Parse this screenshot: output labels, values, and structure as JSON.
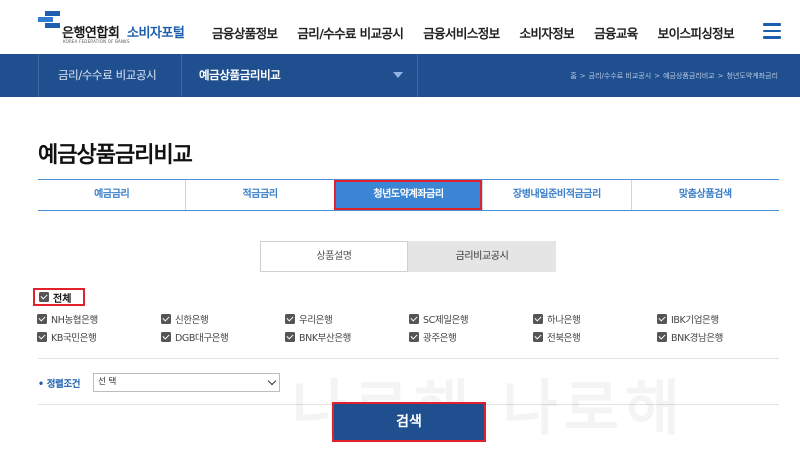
{
  "header": {
    "logo_ko": "은행연합회",
    "logo_en": "KOREA FEDERATION OF BANKS",
    "portal": "소비자포털",
    "gnb": [
      "금융상품정보",
      "금리/수수료 비교공시",
      "금융서비스정보",
      "소비자정보",
      "금융교육",
      "보이스피싱정보"
    ],
    "menu_icon": "hamburger-icon"
  },
  "subnav": {
    "category": "금리/수수료 비교공시",
    "current": "예금상품금리비교",
    "breadcrumb": [
      "홈",
      "금리/수수료 비교공시",
      "예금상품금리비교",
      "청년도약계좌금리"
    ]
  },
  "page_title": "예금상품금리비교",
  "tabs": [
    {
      "label": "예금금리",
      "active": false
    },
    {
      "label": "적금금리",
      "active": false
    },
    {
      "label": "청년도약계좌금리",
      "active": true
    },
    {
      "label": "장병내일준비적금금리",
      "active": false
    },
    {
      "label": "맞춤상품검색",
      "active": false
    }
  ],
  "subtabs": [
    "상품설명",
    "금리비교공시"
  ],
  "check_all": "전체",
  "banks": [
    [
      "NH농협은행",
      "신한은행",
      "우리은행",
      "SC제일은행",
      "하나은행",
      "IBK기업은행"
    ],
    [
      "KB국민은행",
      "DGB대구은행",
      "BNK부산은행",
      "광주은행",
      "전북은행",
      "BNK경남은행"
    ]
  ],
  "sort": {
    "label": "정렬조건",
    "selected": "선 택"
  },
  "watermark": "나로해 나로해",
  "search_button": "검색",
  "colors": {
    "navy": "#1f4f8f",
    "tab_active": "#3a86d4",
    "highlight": "#e0222c"
  }
}
